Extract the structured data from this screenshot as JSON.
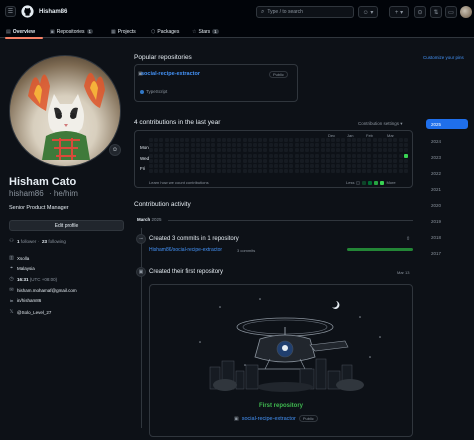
{
  "header": {
    "username": "Hisham86",
    "search_placeholder": "Type / to search"
  },
  "tabs": [
    {
      "label": "Overview",
      "count": ""
    },
    {
      "label": "Repositories",
      "count": "1"
    },
    {
      "label": "Projects",
      "count": ""
    },
    {
      "label": "Packages",
      "count": ""
    },
    {
      "label": "Stars",
      "count": "1"
    }
  ],
  "profile": {
    "name": "Hisham Cato",
    "handle": "hisham86",
    "pronouns": "· he/him",
    "bio": "Senior Product Manager",
    "edit_label": "Edit profile",
    "followers_count": "1",
    "followers_label": "follower ·",
    "following_count": "23",
    "following_label": "following",
    "org": "Xsolla",
    "location": "Malaysia",
    "time": "16:31",
    "tz": "(UTC +08:00)",
    "email": "hisham.mohamaf@gmail.com",
    "linkedin": "in/hisham86",
    "x": "@Solo_Level_27"
  },
  "pinned": {
    "title": "Popular repositories",
    "customize": "Customize your pins",
    "repo_name": "social-recipe-extractor",
    "repo_badge": "Public",
    "language": "TypeScript",
    "language_color": "#3178c6"
  },
  "contributions": {
    "title": "4 contributions in the last year",
    "settings": "Contribution settings ▾",
    "months": [
      "Dec",
      "Jan",
      "Feb",
      "Mar"
    ],
    "days": [
      "Mon",
      "Wed",
      "Fri"
    ],
    "learn": "Learn how we count contributions",
    "less": "Less",
    "more": "More",
    "active_color": "#39d353",
    "empty_color": "#161b22"
  },
  "years": [
    "2025",
    "2024",
    "2023",
    "2022",
    "2021",
    "2020",
    "2019",
    "2018",
    "2017"
  ],
  "activity": {
    "title": "Contribution activity",
    "month": "March",
    "year": "2025",
    "commits_title": "Created 3 commits in 1 repository",
    "commit_repo": "Hisham86/social-recipe-extractor",
    "commit_count": "3 commits",
    "first_repo_title": "Created their first repository",
    "first_repo_date": "Mar 13",
    "first_label": "First repository",
    "first_repo_name": "social-recipe-extractor",
    "first_repo_badge": "Public"
  }
}
